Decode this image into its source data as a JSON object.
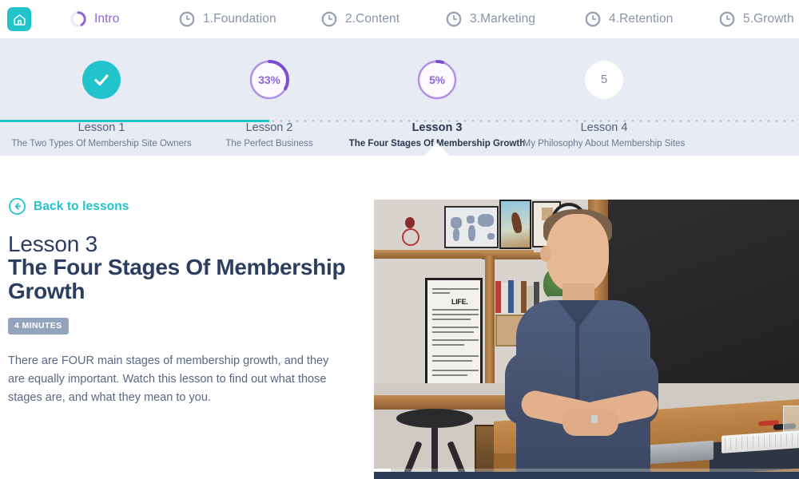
{
  "topnav": {
    "home_icon": "home-icon",
    "items": [
      {
        "label": "Intro",
        "icon": "progress-donut-icon",
        "state": "active"
      },
      {
        "label": "1.Foundation",
        "icon": "clock-icon",
        "state": "locked"
      },
      {
        "label": "2.Content",
        "icon": "clock-icon",
        "state": "locked"
      },
      {
        "label": "3.Marketing",
        "icon": "clock-icon",
        "state": "locked"
      },
      {
        "label": "4.Retention",
        "icon": "clock-icon",
        "state": "locked"
      },
      {
        "label": "5.Growth",
        "icon": "clock-icon",
        "state": "locked"
      }
    ]
  },
  "stepper": {
    "steps": [
      {
        "title": "Lesson 1",
        "subtitle": "The Two Types Of Membership Site Owners",
        "badge": "check-icon",
        "progress": "100",
        "state": "complete"
      },
      {
        "title": "Lesson 2",
        "subtitle": "The Perfect Business",
        "badge": "33%",
        "progress": "33",
        "state": "in-progress"
      },
      {
        "title": "Lesson 3",
        "subtitle": "The Four Stages Of Membership Growth",
        "badge": "5%",
        "progress": "5",
        "state": "active"
      },
      {
        "title": "Lesson 4",
        "subtitle": "My Philosophy About Membership Sites",
        "badge": "5",
        "progress": "0",
        "state": "not-started"
      }
    ]
  },
  "main": {
    "back_label": "Back to lessons",
    "lesson_eyebrow": "Lesson 3",
    "lesson_title": "The Four Stages Of Membership Growth",
    "duration_badge": "4 MINUTES",
    "description": "There are FOUR main stages of membership growth, and they are equally important.  Watch this lesson to find out what those stages are, and what they mean to you."
  },
  "video": {
    "progress_percent": "4"
  },
  "colors": {
    "teal": "#22c4cc",
    "purple": "#8f63d8",
    "navy": "#2c3e60",
    "band": "#e7ebf4",
    "muted": "#8893a8",
    "badge_bg": "#94a3bd"
  }
}
